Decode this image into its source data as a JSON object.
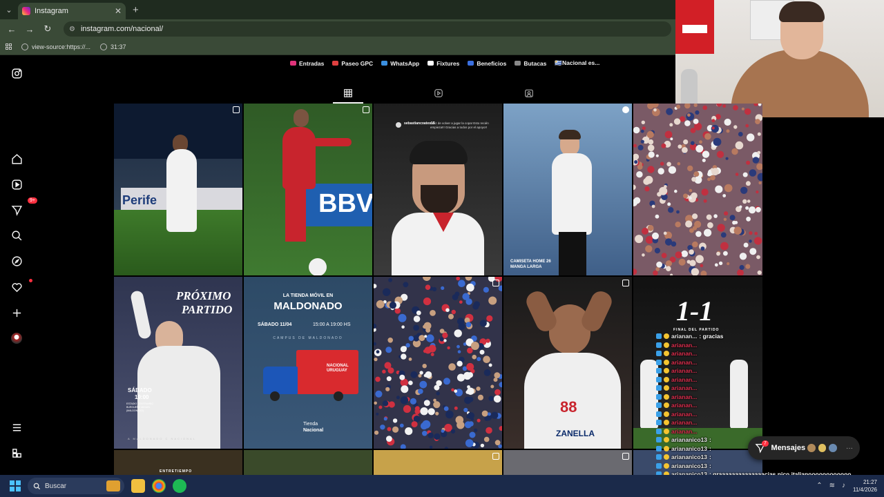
{
  "browser": {
    "tab_title": "Instagram",
    "url": "instagram.com/nacional/",
    "bookmarks": [
      {
        "label": "view-source:https://..."
      },
      {
        "label": "31:37"
      }
    ]
  },
  "highlights": [
    {
      "label": "Entradas",
      "color": "#e0337a"
    },
    {
      "label": "Paseo GPC",
      "color": "#e04040"
    },
    {
      "label": "WhatsApp",
      "color": "#3a8fe0"
    },
    {
      "label": "Fixtures",
      "color": "#ffffff"
    },
    {
      "label": "Beneficios",
      "color": "#3a6fe0"
    },
    {
      "label": "Butacas",
      "color": "#888888"
    },
    {
      "label": "🇺🇾Nacional es...",
      "color": "#000000"
    }
  ],
  "rail": {
    "notifications_badge": "9+"
  },
  "posts": {
    "p3_user": "sebastiancoates15",
    "p3_text": "Feliz de volver a jugar la copa! Esto recién empieza!!! Gracias a todos por el apoyo!!",
    "p4_caption": "CAMISETA HOME 26\nMANGA LARGA",
    "p6_title_1": "PRÓXIMO",
    "p6_title_2": "PARTIDO",
    "p6_day": "SÁBADO",
    "p6_time": "19:00",
    "p6_venue": "ESTADIO CENTENARIO\nBURGUEÑO MIGUEL\n(MALDONADO)",
    "p6_footer": "A MALDONADO C NACIONAL",
    "p7_title_1": "LA TIENDA MÓVIL EN",
    "p7_title_2": "MALDONADO",
    "p7_date": "SÁBADO 11/04",
    "p7_hours": "15:00 A 19:00 HS",
    "p7_place": "CAMPUS DE MALDONADO",
    "p7_truck_text": "NACIONAL\nURUGUAY",
    "p7_logo_1": "Tienda",
    "p7_logo_2": "Nacional",
    "p9_number": "88",
    "p9_brand": "ZANELLA",
    "p10_score": "1-1",
    "p10_sub": "FINAL DEL PARTIDO",
    "p11_label": "ENTRETIEMPO",
    "p2_ad": "BBV",
    "p1_ad": "Perife"
  },
  "chat": [
    {
      "user": "arianan...",
      "msg": ": gracias",
      "style": "w"
    },
    {
      "user": "arianan...",
      "msg": "",
      "style": "r"
    },
    {
      "user": "arianan...",
      "msg": "",
      "style": "r"
    },
    {
      "user": "arianan...",
      "msg": "",
      "style": "r"
    },
    {
      "user": "arianan...",
      "msg": "",
      "style": "r"
    },
    {
      "user": "arianan...",
      "msg": "",
      "style": "r"
    },
    {
      "user": "arianan...",
      "msg": "",
      "style": "r"
    },
    {
      "user": "arianan...",
      "msg": "",
      "style": "r"
    },
    {
      "user": "arianan...",
      "msg": "",
      "style": "r"
    },
    {
      "user": "arianan...",
      "msg": "",
      "style": "r"
    },
    {
      "user": "arianan...",
      "msg": "",
      "style": "r"
    },
    {
      "user": "arianan...",
      "msg": "",
      "style": "r"
    },
    {
      "user": "ariananico13",
      "msg": ":",
      "style": "w"
    },
    {
      "user": "ariananico13",
      "msg": ":",
      "style": "w"
    },
    {
      "user": "ariananico13",
      "msg": ":",
      "style": "w"
    },
    {
      "user": "ariananico13",
      "msg": ":",
      "style": "w"
    },
    {
      "user": "ariananico13",
      "msg": ": graaaaaaaaaaaaaacias nico italianoooooooooooo",
      "style": "w"
    }
  ],
  "messages": {
    "label": "Mensajes",
    "badge": "7"
  },
  "taskbar": {
    "search": "Buscar",
    "time": "21:27",
    "date": "11/4/2026"
  },
  "colors": {
    "background": "#000000",
    "accent_red": "#ff3040",
    "taskbar": "#1b2a4a"
  }
}
